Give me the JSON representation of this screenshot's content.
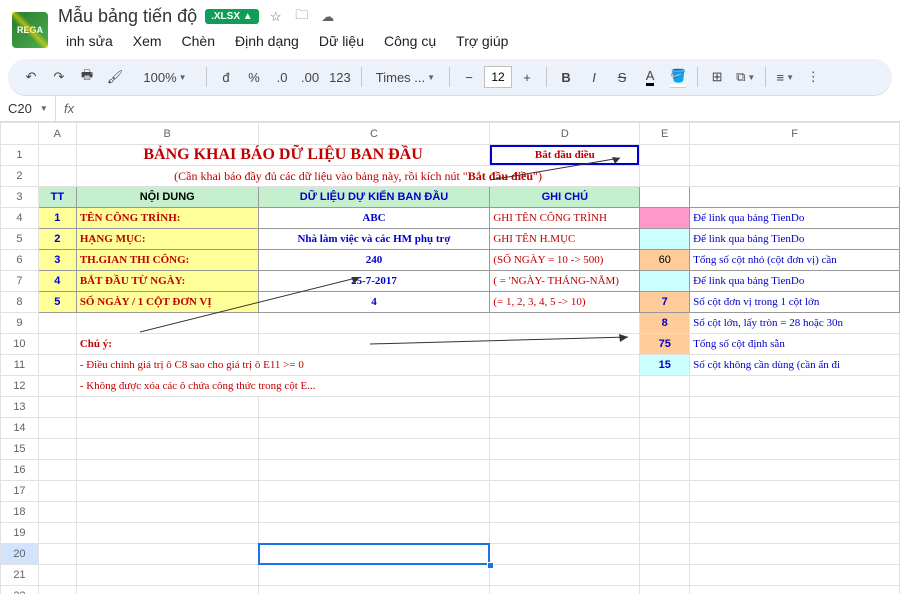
{
  "doc": {
    "title": "Mẫu bảng tiến độ",
    "badge": ".XLSX"
  },
  "menu": [
    "inh sửa",
    "Xem",
    "Chèn",
    "Định dạng",
    "Dữ liệu",
    "Công cụ",
    "Trợ giúp"
  ],
  "toolbar": {
    "zoom": "100%",
    "font": "Times ...",
    "size": "12"
  },
  "namebox": "C20",
  "sheet": {
    "title": "BẢNG KHAI BÁO DỮ LIỆU BAN ĐẦU",
    "subtitle_prefix": "(Cần khai báo đầy đủ các dữ liệu vào bảng này, rồi kích nút \"",
    "subtitle_bold": "Bắt đầu điều",
    "subtitle_suffix": "\")",
    "button": "Bắt đầu điều",
    "headers": {
      "tt": "TT",
      "nd": "NỘI DUNG",
      "dl": "DỮ LIỆU DỰ KIẾN BAN ĐẦU",
      "gc": "GHI CHÚ"
    },
    "rows": [
      {
        "n": "1",
        "label": "TÊN CÔNG TRÌNH:",
        "val": "ABC",
        "note": "GHI TÊN CÔNG TRÌNH"
      },
      {
        "n": "2",
        "label": "HẠNG MỤC:",
        "val": "Nhà làm việc và các HM phụ trợ",
        "note": "GHI TÊN H.MỤC"
      },
      {
        "n": "3",
        "label": "TH.GIAN THI CÔNG:",
        "val": "240",
        "note": "(SỐ NGÀY = 10 -> 500)"
      },
      {
        "n": "4",
        "label": "BẮT ĐẦU TỪ NGÀY:",
        "val": "25-7-2017",
        "note": "( = 'NGÀY- THÁNG-NĂM)"
      },
      {
        "n": "5",
        "label": "SỐ NGÀY / 1 CỘT ĐƠN VỊ",
        "val": "4",
        "note": "(= 1, 2, 3, 4, 5 -> 10)"
      }
    ],
    "chu_y": "Chú ý:",
    "note1": "- Điều chỉnh giá trị ô C8 sao cho giá trị ô E11 >= 0",
    "note2": "- Không được xóa các ô chứa công thức trong cột E...",
    "side": [
      {
        "e": "",
        "ec": "e-pink",
        "f": "Để link qua bảng TienDo"
      },
      {
        "e": "",
        "ec": "e-cyan",
        "f": "Để link qua bảng TienDo"
      },
      {
        "e": "60",
        "ec": "e-orange",
        "f": "Tổng số cột nhỏ (cột đơn vị) cần"
      },
      {
        "e": "",
        "ec": "e-cyan",
        "f": "Để link qua bảng TienDo"
      },
      {
        "e": "7",
        "ec": "e-orange",
        "f": "Số cột đơn vị trong 1 cột lớn"
      },
      {
        "e": "8",
        "ec": "e-orange",
        "f": "Số cột lớn, lấy tròn  = 28 hoặc 30n"
      },
      {
        "e": "75",
        "ec": "e-orange",
        "f": "Tổng số cột định sẵn"
      },
      {
        "e": "15",
        "ec": "e-cyan",
        "f": "Số cột không cần dùng (cần ẩn đi"
      }
    ]
  }
}
